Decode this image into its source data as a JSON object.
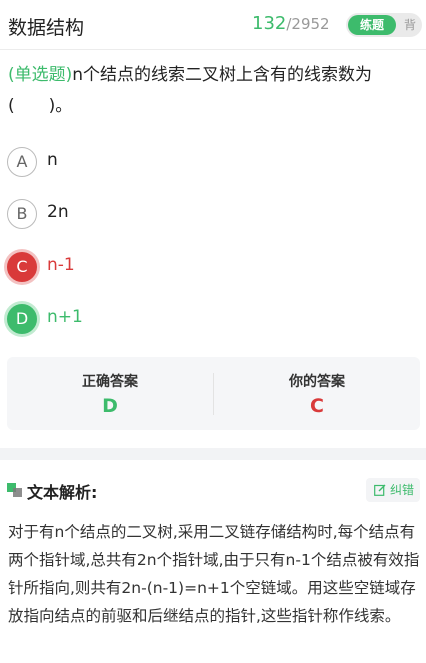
{
  "header": {
    "title": "数据结构",
    "progress_current": "132",
    "progress_sep": "/",
    "progress_total": "2952",
    "mode_active": "练题",
    "mode_inactive": "背"
  },
  "question": {
    "type_label": "(单选题)",
    "text": "n个结点的线索二叉树上含有的线索数为(　　)。"
  },
  "options": [
    {
      "letter": "A",
      "text": "n",
      "state": "normal"
    },
    {
      "letter": "B",
      "text": "2n",
      "state": "normal"
    },
    {
      "letter": "C",
      "text": "n-1",
      "state": "wrong"
    },
    {
      "letter": "D",
      "text": "n+1",
      "state": "correct"
    }
  ],
  "answer_box": {
    "correct_label": "正确答案",
    "correct_value": "D",
    "yours_label": "你的答案",
    "yours_value": "C"
  },
  "colors": {
    "accent_green": "#3dbb6c",
    "error_red": "#d93a3a"
  },
  "analysis": {
    "title": "文本解析:",
    "report_label": "纠错",
    "body": "对于有n个结点的二叉树,采用二叉链存储结构时,每个结点有两个指针域,总共有2n个指针域,由于只有n-1个结点被有效指针所指向,则共有2n-(n-1)=n+1个空链域。用这些空链域存放指向结点的前驱和后继结点的指针,这些指针称作线索。"
  },
  "icons": {
    "analysis_icon": "analysis-squares-icon",
    "report_icon": "edit-icon"
  }
}
